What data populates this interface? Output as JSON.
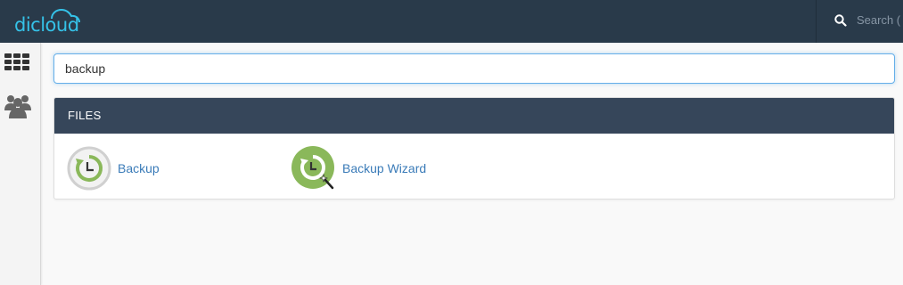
{
  "app": {
    "brand": "dicloud"
  },
  "topbar": {
    "search_placeholder": "Search ( / )"
  },
  "sidebar": {
    "items": [
      {
        "name": "tools",
        "icon": "grid-icon"
      },
      {
        "name": "users",
        "icon": "users-icon"
      }
    ]
  },
  "search": {
    "value": "backup"
  },
  "panel": {
    "title": "FILES",
    "items": [
      {
        "label": "Backup",
        "icon": "backup-icon"
      },
      {
        "label": "Backup Wizard",
        "icon": "backup-wizard-icon"
      }
    ]
  },
  "colors": {
    "topbar": "#293a4a",
    "panel_header": "#36465a",
    "link": "#3a7bb8",
    "logo": "#35c2e8",
    "icon_green": "#8ab85a"
  }
}
